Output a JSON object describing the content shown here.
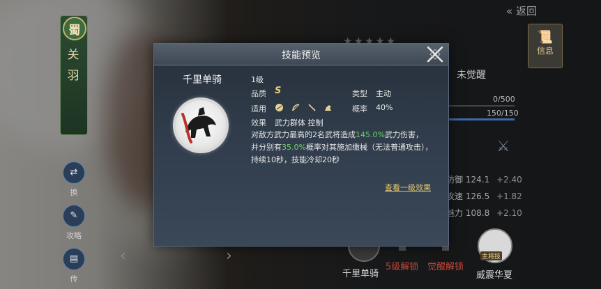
{
  "screen": {
    "back_label": "返回",
    "kingdom": "蜀",
    "hero_name": "关羽",
    "info_tab": "信息",
    "awaken_label": "未觉醒",
    "bar1": "0/500",
    "bar2": "150/150",
    "side_buttons": [
      "换",
      "攻略",
      "传"
    ],
    "stats": [
      {
        "name": "防御",
        "value": "124.1",
        "bonus": "+2.40"
      },
      {
        "name": "攻速",
        "value": "126.5",
        "bonus": "+1.82"
      },
      {
        "name": "魅力",
        "value": "108.8",
        "bonus": "+2.10"
      }
    ],
    "skills": [
      {
        "label": "千里单骑"
      },
      {
        "label": "5级解锁"
      },
      {
        "label": "觉醒解锁"
      },
      {
        "label": "威震华夏"
      }
    ],
    "skill_badge": "主将技"
  },
  "modal": {
    "title": "技能预览",
    "skill_name": "千里单骑",
    "level": "1级",
    "quality_label": "品质",
    "quality_value": "S",
    "type_label": "类型",
    "type_value": "主动",
    "applies_label": "适用",
    "applies_icons": [
      "shield-icon",
      "bow-icon",
      "spear-icon",
      "horse-icon"
    ],
    "chance_label": "概率",
    "chance_value": "40%",
    "effect_label": "效果",
    "effect_value": "武力群体 控制",
    "desc_1": "对敌方武力最高的2名武将造成",
    "desc_pct1": "145.0%",
    "desc_2": "武力伤害，",
    "desc_3": "并分别有",
    "desc_pct2": "35.0%",
    "desc_4": "概率对其施加缴械（无法普通攻击），持续10秒，技能冷却20秒",
    "link": "查看一级效果"
  }
}
